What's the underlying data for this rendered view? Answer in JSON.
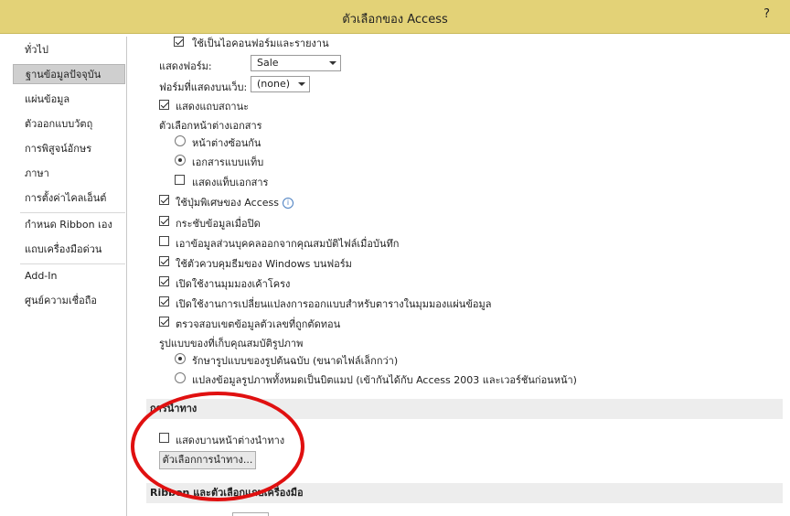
{
  "window": {
    "title": "ตัวเลือกของ Access",
    "help": "?"
  },
  "sidebar": {
    "items": [
      {
        "label": "ทั่วไป"
      },
      {
        "label": "ฐานข้อมูลปัจจุบัน"
      },
      {
        "label": "แผ่นข้อมูล"
      },
      {
        "label": "ตัวออกแบบวัตถุ"
      },
      {
        "label": "การพิสูจน์อักษร"
      },
      {
        "label": "ภาษา"
      },
      {
        "label": "การตั้งค่าไคลเอ็นต์"
      },
      {
        "label": "กำหนด Ribbon เอง"
      },
      {
        "label": "แถบเครื่องมือด่วน"
      },
      {
        "label": "Add-In"
      },
      {
        "label": "ศูนย์ความเชื่อถือ"
      }
    ],
    "selected_index": 1
  },
  "content": {
    "top_checkbox_label": "ใช้เป็นไอคอนฟอร์มและรายงาน",
    "display_form": {
      "label": "แสดงฟอร์ม:",
      "value": "Sale"
    },
    "web_display_form": {
      "label": "ฟอร์มที่แสดงบนเว็บ:",
      "value": "(none)"
    },
    "show_status_bar": "แสดงแถบสถานะ",
    "document_window_options": {
      "label": "ตัวเลือกหน้าต่างเอกสาร",
      "overlapping": "หน้าต่างซ้อนกัน",
      "tabbed": "เอกสารแบบแท็บ",
      "show_tabs": "แสดงแท็บเอกสาร"
    },
    "use_special_keys": "ใช้ปุ่มพิเศษของ Access",
    "compact_on_close": "กระชับข้อมูลเมื่อปิด",
    "remove_personal_info": "เอาข้อมูลส่วนบุคคลออกจากคุณสมบัติไฟล์เมื่อบันทึก",
    "use_windows_themed": "ใช้ตัวควบคุมธีมของ Windows บนฟอร์ม",
    "enable_layout_view": "เปิดใช้งานมุมมองเค้าโครง",
    "enable_design_changes": "เปิดใช้งานการเปลี่ยนแปลงการออกแบบสำหรับตารางในมุมมองแผ่นข้อมูล",
    "check_truncated": "ตรวจสอบเขตข้อมูลตัวเลขที่ถูกตัดทอน",
    "picture_storage": {
      "label": "รูปแบบของที่เก็บคุณสมบัติรูปภาพ",
      "preserve": "รักษารูปแบบของรูปต้นฉบับ (ขนาดไฟล์เล็กกว่า)",
      "convert": "แปลงข้อมูลรูปภาพทั้งหมดเป็นบิตแมป (เข้ากันได้กับ Access 2003 และเวอร์ชันก่อนหน้า)"
    },
    "navigation": {
      "header": "การนำทาง",
      "show_nav_pane": "แสดงบานหน้าต่างนำทาง",
      "nav_options_button": "ตัวเลือกการนำทาง..."
    },
    "ribbon_header": "Ribbon และตัวเลือกแถบเครื่องมือ"
  },
  "colors": {
    "titlebar": "#e3d277",
    "highlight_ring": "#e01010"
  }
}
